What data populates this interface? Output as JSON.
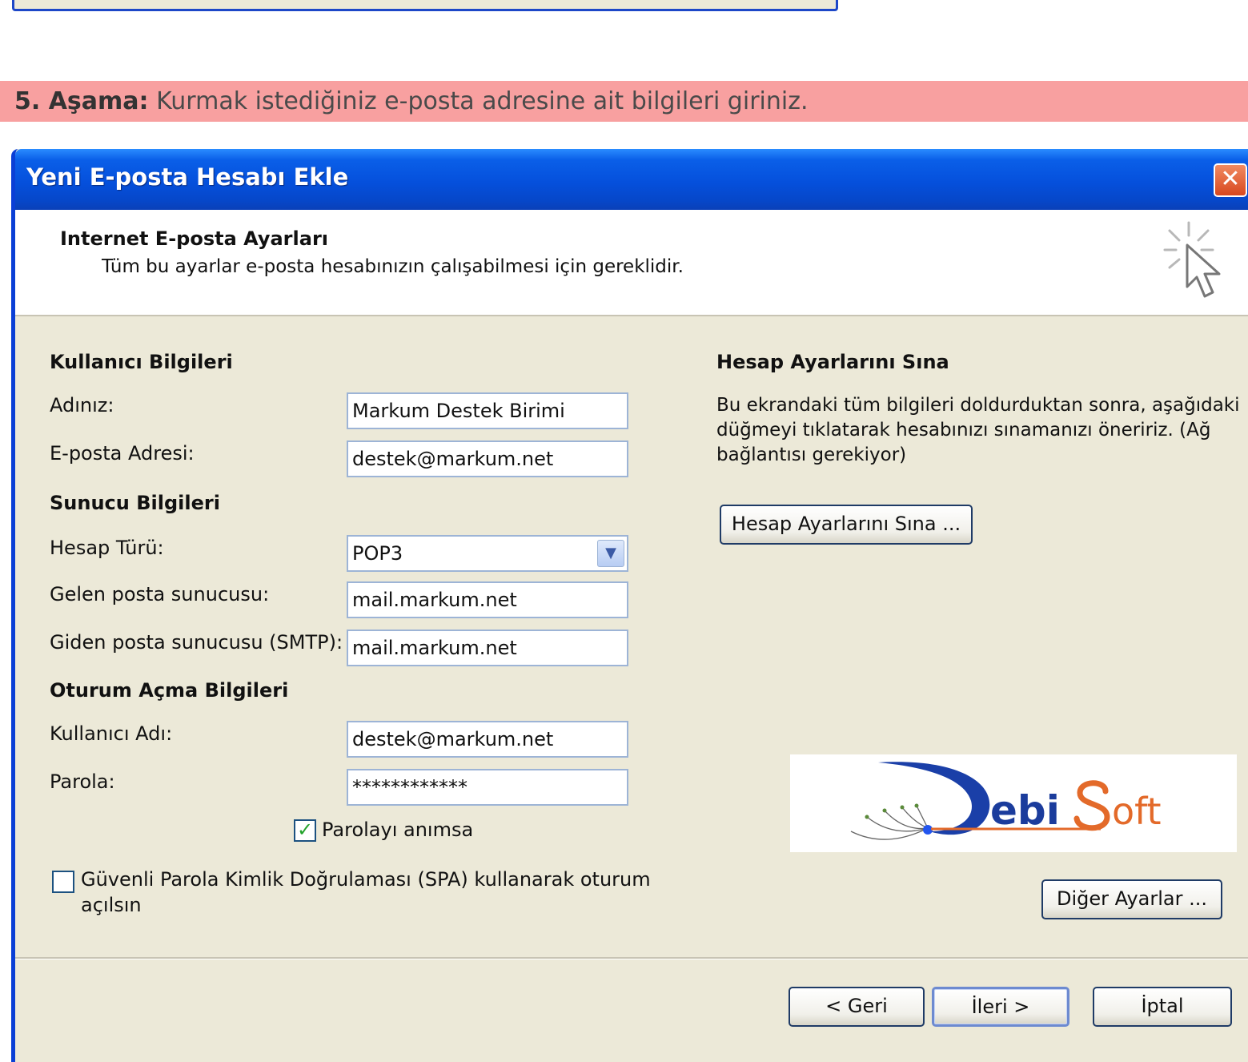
{
  "banner": {
    "step": "5. Aşama:",
    "instruction": "Kurmak istediğiniz e-posta adresine ait bilgileri giriniz."
  },
  "dialog": {
    "title": "Yeni E-posta Hesabı Ekle",
    "close_icon": "close-icon",
    "header": {
      "title": "Internet E-posta Ayarları",
      "subtitle": "Tüm bu ayarlar e-posta hesabınızın çalışabilmesi için gereklidir.",
      "icon": "wizard-cursor-icon"
    },
    "user_info": {
      "heading": "Kullanıcı Bilgileri",
      "name_label": "Adınız:",
      "name_value": "Markum Destek Birimi",
      "email_label": "E-posta Adresi:",
      "email_value": "destek@markum.net"
    },
    "server_info": {
      "heading": "Sunucu Bilgileri",
      "account_type_label": "Hesap Türü:",
      "account_type_value": "POP3",
      "incoming_label": "Gelen posta sunucusu:",
      "incoming_value": "mail.markum.net",
      "outgoing_label": "Giden posta sunucusu (SMTP):",
      "outgoing_value": "mail.markum.net"
    },
    "logon_info": {
      "heading": "Oturum Açma Bilgileri",
      "username_label": "Kullanıcı Adı:",
      "username_value": "destek@markum.net",
      "password_label": "Parola:",
      "password_value": "************",
      "remember_label": "Parolayı anımsa",
      "remember_checked": true,
      "spa_label_line1": "Güvenli Parola Kimlik Doğrulaması (SPA) kullanarak oturum",
      "spa_label_line2": "açılsın",
      "spa_checked": false
    },
    "test_settings": {
      "heading": "Hesap Ayarlarını Sına",
      "description_line1": "Bu ekrandaki tüm bilgileri doldurduktan sonra, aşağıdaki",
      "description_line2": "düğmeyi tıklatarak hesabınızı sınamanızı öneririz. (Ağ",
      "description_line3": "bağlantısı gerekiyor)",
      "button": "Hesap Ayarlarını Sına ..."
    },
    "logo_text_1": "ebi",
    "logo_text_2": "oft",
    "more_settings_button": "Diğer Ayarlar ...",
    "back_button": "< Geri",
    "next_button": "İleri >",
    "cancel_button": "İptal"
  }
}
